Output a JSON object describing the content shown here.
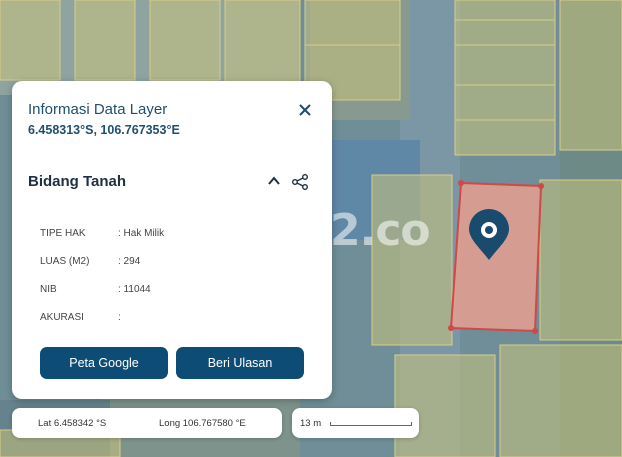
{
  "panel": {
    "title": "Informasi Data Layer",
    "coords": "6.458313°S, 106.767353°E",
    "section_title": "Bidang Tanah",
    "fields": [
      {
        "key": "TIPE HAK",
        "value": ": Hak Milik"
      },
      {
        "key": "LUAS (M2)",
        "value": ": 294"
      },
      {
        "key": "NIB",
        "value": ": 11044"
      },
      {
        "key": "AKURASI",
        "value": ":"
      }
    ],
    "buttons": {
      "google": "Peta Google",
      "review": "Beri Ulasan"
    }
  },
  "coordbar": {
    "lat": "Lat 6.458342 °S",
    "long": "Long 106.767580 °E"
  },
  "scale": {
    "label": "13 m"
  },
  "watermark": "2.co",
  "colors": {
    "accent": "#0d4d75",
    "parcel": "#e8a090",
    "parcel_border": "#d04848",
    "marker": "#1a4b6c"
  },
  "icons": {
    "close": "close-icon",
    "collapse": "chevron-up-icon",
    "share": "share-icon",
    "marker": "map-pin-icon"
  }
}
